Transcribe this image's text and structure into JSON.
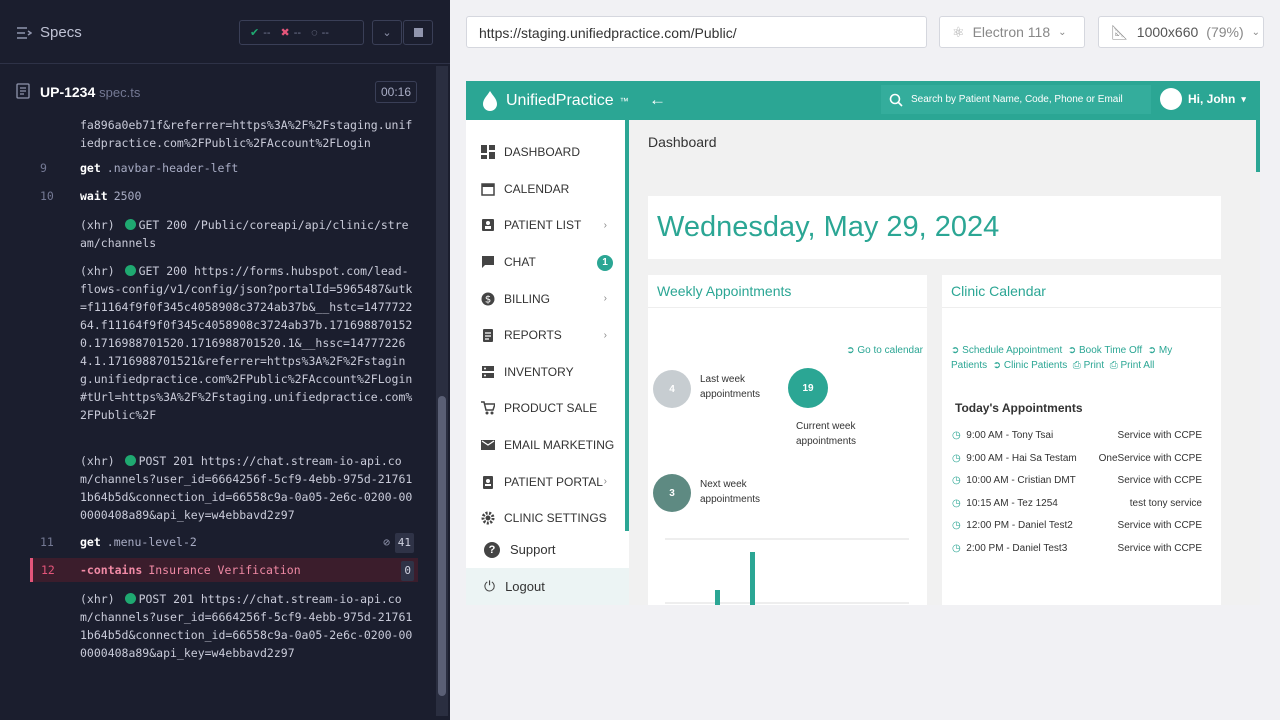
{
  "runner": {
    "specs_title": "Specs",
    "passed": "--",
    "failed": "--",
    "pending": "--",
    "spec_name": "UP-1234",
    "spec_ext": "spec.ts",
    "duration": "00:16",
    "url_tail": "fa896a0eb71f&referrer=https%3A%2F%2Fstaging.unifiedpractice.com%2FPublic%2FAccount%2FLogin",
    "commands": [
      {
        "num": "9",
        "name": "get",
        "arg": ".navbar-header-left"
      },
      {
        "num": "10",
        "name": "wait",
        "arg": "2500"
      },
      {
        "num": "11",
        "name": "get",
        "arg": ".menu-level-2",
        "badge": "41"
      },
      {
        "num": "12",
        "name": "-contains",
        "arg": "Insurance Verification",
        "badge": "0"
      }
    ],
    "xhr": [
      {
        "label": "(xhr)",
        "text": "GET 200 /Public/coreapi/api/clinic/stream/channels"
      },
      {
        "label": "(xhr)",
        "text": "GET 200 https://forms.hubspot.com/lead-flows-config/v1/config/json?portalId=5965487&utk=f11164f9f0f345c4058908c3724ab37b&__hstc=147772264.f11164f9f0f345c4058908c3724ab37b.1716988701520.1716988701520.1716988701520.1&__hssc=147772264.1.1716988701521&referrer=https%3A%2F%2Fstaging.unifiedpractice.com%2FPublic%2FAccount%2FLogin#tUrl=https%3A%2F%2Fstaging.unifiedpractice.com%2FPublic%2F"
      },
      {
        "label": "(xhr)",
        "text": "POST 201 https://chat.stream-io-api.com/channels?user_id=6664256f-5cf9-4ebb-975d-217611b64b5d&connection_id=66558c9a-0a05-2e6c-0200-000000408a89&api_key=w4ebbavd2z97"
      },
      {
        "label": "(xhr)",
        "text": "POST 201 https://chat.stream-io-api.com/channels?user_id=6664256f-5cf9-4ebb-975d-217611b64b5d&connection_id=66558c9a-0a05-2e6c-0200-000000408a89&api_key=w4ebbavd2z97"
      }
    ]
  },
  "browser": {
    "url": "https://staging.unifiedpractice.com/Public/",
    "browser": "Electron 118",
    "viewport": "1000x660",
    "zoom": "(79%)"
  },
  "app": {
    "brand": "UnifiedPractice",
    "search_placeholder": "Search by Patient Name, Code, Phone or Email",
    "greeting": "Hi, John",
    "menu": [
      {
        "label": "DASHBOARD",
        "icon": "dashboard-icon"
      },
      {
        "label": "CALENDAR",
        "icon": "calendar-icon"
      },
      {
        "label": "PATIENT LIST",
        "icon": "patient-list-icon",
        "chevron": true
      },
      {
        "label": "CHAT",
        "icon": "chat-icon",
        "count": "1"
      },
      {
        "label": "BILLING",
        "icon": "billing-icon",
        "chevron": true
      },
      {
        "label": "REPORTS",
        "icon": "reports-icon",
        "chevron": true
      },
      {
        "label": "INVENTORY",
        "icon": "inventory-icon"
      },
      {
        "label": "PRODUCT SALE",
        "icon": "cart-icon"
      },
      {
        "label": "EMAIL MARKETING",
        "icon": "email-icon"
      },
      {
        "label": "PATIENT PORTAL",
        "icon": "portal-icon",
        "chevron": true
      },
      {
        "label": "CLINIC SETTINGS",
        "icon": "settings-icon",
        "chevron": true
      }
    ],
    "support": "Support",
    "logout": "Logout",
    "page_title": "Dashboard",
    "date": "Wednesday, May 29, 2024",
    "weekly": {
      "title": "Weekly Appointments",
      "go_calendar": "Go to calendar",
      "last_week_count": "4",
      "last_week_label": "Last week appointments",
      "current_week_count": "19",
      "current_week_label": "Current week appointments",
      "next_week_count": "3",
      "next_week_label": "Next week appointments"
    },
    "calendar": {
      "title": "Clinic Calendar",
      "links": [
        "Schedule Appointment",
        "Book Time Off",
        "My Patients",
        "Clinic Patients",
        "Print",
        "Print All"
      ],
      "today_title": "Today's Appointments",
      "appointments": [
        {
          "time": "9:00 AM - Tony Tsai",
          "service": "Service with CCPE"
        },
        {
          "time": "9:00 AM - Hai Sa Testam",
          "service": "OneService with CCPE"
        },
        {
          "time": "10:00 AM - Cristian DMT",
          "service": "Service with CCPE"
        },
        {
          "time": "10:15 AM - Tez 1254",
          "service": "test tony service"
        },
        {
          "time": "12:00 PM - Daniel Test2",
          "service": "Service with CCPE"
        },
        {
          "time": "2:00 PM - Daniel Test3",
          "service": "Service with CCPE"
        }
      ]
    }
  }
}
